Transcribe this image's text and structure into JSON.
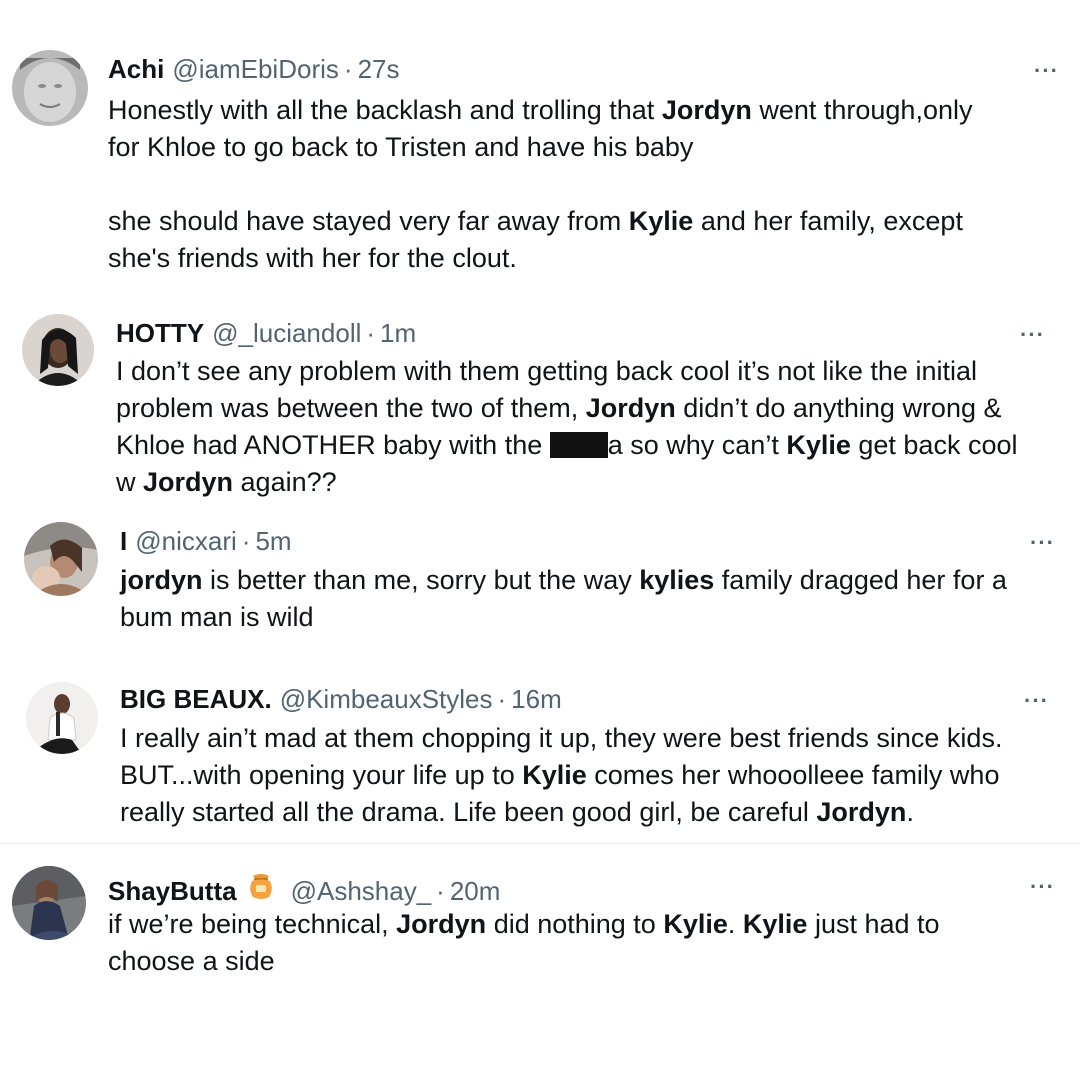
{
  "tweets": [
    {
      "name": "Achi",
      "handle": "@iamEbiDoris",
      "sep": "·",
      "time": "27s",
      "more": "···",
      "line1a": "Honestly with all the  backlash and trolling that ",
      "line1b": "Jordyn",
      "line1c": " went through,only",
      "line2": "for Khloe to go back to Tristen and have his baby",
      "line3a": "she should have stayed very far away from ",
      "line3b": "Kylie",
      "line3c": " and her family, except",
      "line4": "she's friends with her for the clout."
    },
    {
      "name": "HOTTY",
      "handle": "@_luciandoll",
      "sep": "·",
      "time": "1m",
      "more": "···",
      "line1": "I don’t see any problem with them getting back cool it’s not like the initial",
      "line2a": "problem was between the two of them, ",
      "line2b": "Jordyn",
      "line2c": " didn’t do anything wrong &",
      "line3a": "Khloe had ANOTHER baby with the ",
      "line3b": "a so why can’t ",
      "line3c": "Kylie",
      "line3d": " get back cool",
      "line4a": "w ",
      "line4b": "Jordyn",
      "line4c": " again??"
    },
    {
      "name": "I",
      "handle": "@nicxari",
      "sep": "·",
      "time": "5m",
      "more": "···",
      "line1a": "jordyn",
      "line1b": " is better than me, sorry but the way ",
      "line1c": "kylies",
      "line1d": " family dragged her for a",
      "line2": "bum man is wild"
    },
    {
      "name": "BIG BEAUX.",
      "handle": "@KimbeauxStyles",
      "sep": "·",
      "time": "16m",
      "more": "···",
      "line1": "I really ain’t mad at them chopping it up, they were best friends since kids.",
      "line2a": "BUT...with opening your life up to ",
      "line2b": "Kylie",
      "line2c": " comes her whooolleee family who",
      "line3a": "really started all the drama. Life been good girl, be careful ",
      "line3b": "Jordyn",
      "line3c": "."
    },
    {
      "name": "ShayButta",
      "handle": "@Ashshay_",
      "sep": "·",
      "time": "20m",
      "more": "···",
      "line1a": "if we’re being technical, ",
      "line1b": "Jordyn",
      "line1c": " did nothing to ",
      "line1d": "Kylie",
      "line1e": ". ",
      "line1f": "Kylie",
      "line1g": " just had to",
      "line2": "choose a side"
    }
  ],
  "icons": {
    "avatar": "user-avatar",
    "more": "more-options-icon",
    "emoji": "honey-pot-icon"
  }
}
